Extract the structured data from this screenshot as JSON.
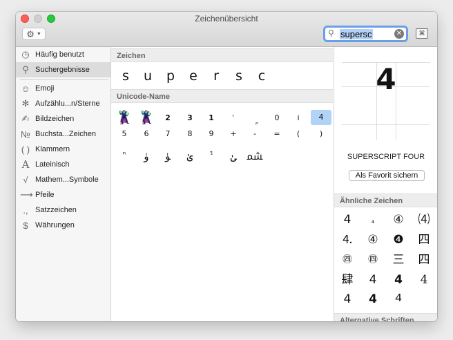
{
  "window": {
    "title": "Zeichenübersicht"
  },
  "search": {
    "value": "supersc"
  },
  "sidebar": {
    "items": [
      {
        "label": "Häufig benutzt",
        "icon": "clock-icon"
      },
      {
        "label": "Suchergebnisse",
        "icon": "search-icon"
      },
      {
        "label": "Emoji",
        "icon": "smiley-icon"
      },
      {
        "label": "Aufzählu...n/Sterne",
        "icon": "asterisk-icon"
      },
      {
        "label": "Bildzeichen",
        "icon": "pictograph-icon"
      },
      {
        "label": "Buchsta...Zeichen",
        "icon": "numero-icon"
      },
      {
        "label": "Klammern",
        "icon": "parentheses-icon"
      },
      {
        "label": "Lateinisch",
        "icon": "latin-a-icon"
      },
      {
        "label": "Mathem...Symbole",
        "icon": "sqrt-icon"
      },
      {
        "label": "Pfeile",
        "icon": "arrow-icon"
      },
      {
        "label": "Satzzeichen",
        "icon": "punctuation-icon"
      },
      {
        "label": "Währungen",
        "icon": "dollar-icon"
      }
    ]
  },
  "main": {
    "section_chars": "Zeichen",
    "chars": [
      "s",
      "u",
      "p",
      "e",
      "r",
      "s",
      "c"
    ],
    "section_unicode": "Unicode-Name",
    "rows": [
      [
        "🦹‍♀️",
        "🦹‍♂️",
        "2",
        "3",
        "1",
        "ʾ",
        "ࣩ",
        "0",
        "i",
        "4"
      ],
      [
        "5",
        "6",
        "7",
        "8",
        "9",
        "+",
        "-",
        "=",
        "(",
        ")"
      ],
      [
        "ⁿ",
        "ﯛ",
        "ﯜ",
        "ﱝ",
        "ﱞ",
        "ﲐ",
        "ﳩ"
      ]
    ]
  },
  "detail": {
    "glyph": "4",
    "name": "SUPERSCRIPT FOUR",
    "favorite_label": "Als Favorit sichern",
    "similar_header": "Ähnliche Zeichen",
    "similar": [
      [
        "4",
        "₄",
        "④",
        "⑷"
      ],
      [
        "⒋",
        "④",
        "❹",
        "四"
      ],
      [
        "㊃",
        "㊃",
        "三",
        "四"
      ],
      [
        "肆",
        "4",
        "4",
        "4"
      ],
      [
        "4",
        "4",
        "4"
      ]
    ],
    "alt_header": "Alternative Schriften"
  },
  "colors": {
    "selection": "#b1d3f7",
    "search_focus": "#6b9ee9"
  }
}
